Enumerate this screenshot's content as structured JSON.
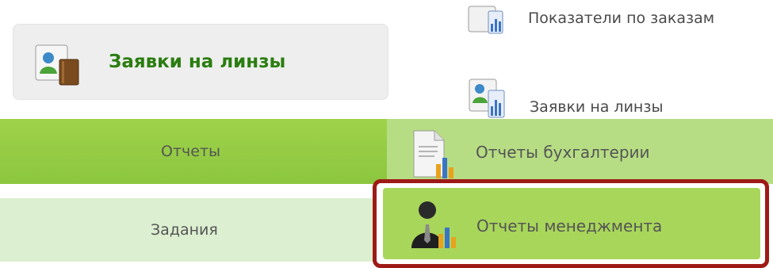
{
  "left_card": {
    "label": "Заявки на линзы",
    "icon": "user-report-icon"
  },
  "right_menu": {
    "items": [
      {
        "label": "Показатели по заказам",
        "icon": "chart-window-icon"
      },
      {
        "label": "Заявки на линзы",
        "icon": "user-chart-icon"
      }
    ]
  },
  "nav": {
    "reports_label": "Отчеты",
    "tasks_label": "Задания"
  },
  "submenu": {
    "accounting_label": "Отчеты бухгалтерии",
    "accounting_icon": "document-chart-icon",
    "management_label": "Отчеты менеджмента",
    "management_icon": "manager-chart-icon"
  },
  "colors": {
    "accent_green": "#8cc63f",
    "highlight_red": "#9e1a16",
    "label_green": "#2a7d10"
  }
}
